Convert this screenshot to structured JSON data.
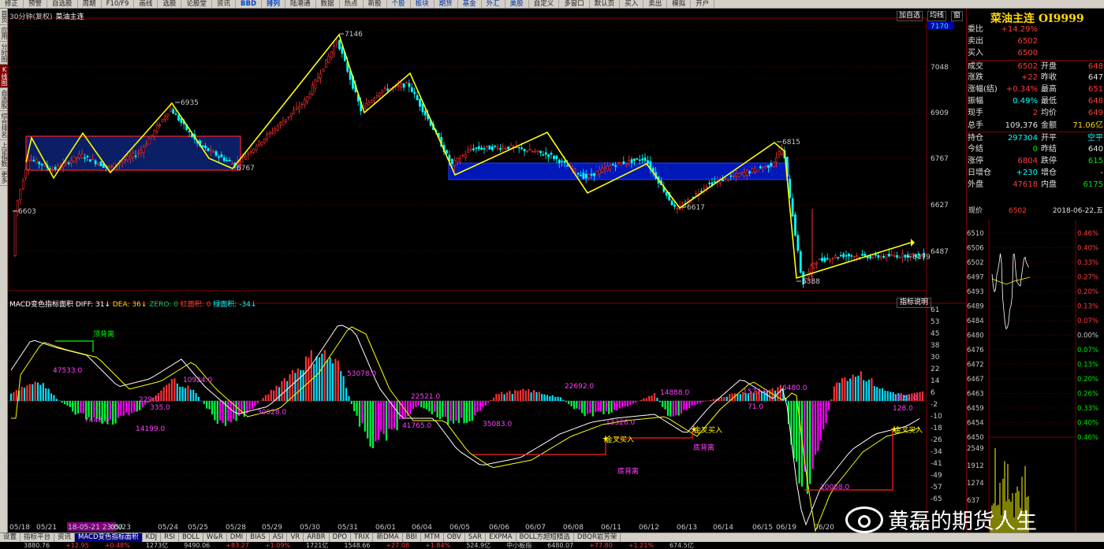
{
  "toolbar": {
    "items": [
      "修正",
      "预警",
      "自选股",
      "周期",
      "F10/F9",
      "画线",
      "选股",
      "论股堂",
      "资讯",
      "BBD",
      "排列",
      "陆港通",
      "数据",
      "热点",
      "新股",
      "个股",
      "板块",
      "期货",
      "基金",
      "外汇",
      "美股",
      "自定义",
      "多窗口",
      "默认页",
      "买入",
      "卖出",
      "模拟",
      "开户"
    ]
  },
  "sidebar": {
    "tabs": [
      "首页",
      "应用",
      "分时图",
      "K线图",
      "自选股",
      "综合排名",
      "上证指数",
      "更多"
    ],
    "active": "K线图"
  },
  "chart_header": {
    "period": "30分钟(复权)",
    "title": "菜油主连"
  },
  "chart_tools": [
    "加自选",
    "均线",
    "窗"
  ],
  "macd_header": {
    "name": "MACD变色指标面积",
    "diff": "DIFF: 31",
    "dea": "DEA: 36",
    "zero": "ZERO: 0",
    "red_area": "红面积: 0",
    "green_area": "绿面积: -34",
    "help": "指标说明"
  },
  "quote": {
    "title": "菜油主连 OI9999",
    "rows": [
      {
        "l": "委比",
        "v": "+14.29%",
        "vc": "red"
      },
      {
        "l": "卖出",
        "v": "6502",
        "vc": "red"
      },
      {
        "l": "买入",
        "v": "6500",
        "vc": "red"
      },
      {
        "l": "成交",
        "v": "6502",
        "vc": "red",
        "l2": "开盘",
        "v2": "648",
        "v2c": "red",
        "sep": true
      },
      {
        "l": "涨跌",
        "v": "+22",
        "vc": "red",
        "l2": "昨收",
        "v2": "647",
        "v2c": "white"
      },
      {
        "l": "涨幅(结)",
        "v": "+0.34%",
        "vc": "red",
        "l2": "最高",
        "v2": "651",
        "v2c": "red"
      },
      {
        "l": "振幅",
        "v": "0.49%",
        "vc": "cyan",
        "l2": "最低",
        "v2": "648",
        "v2c": "red"
      },
      {
        "l": "现手",
        "v": "2",
        "vc": "red",
        "l2": "均价",
        "v2": "649",
        "v2c": "red"
      },
      {
        "l": "总手",
        "v": "109,376",
        "vc": "white",
        "l2": "金额",
        "v2": "71.06亿",
        "v2c": "yellow"
      },
      {
        "l": "持仓",
        "v": "297304",
        "vc": "cyan",
        "l2": "开平",
        "v2": "空平",
        "v2c": "cyan",
        "sep": true
      },
      {
        "l": "今结",
        "v": "0",
        "vc": "green",
        "l2": "昨结",
        "v2": "640",
        "v2c": "white"
      },
      {
        "l": "涨停",
        "v": "6804",
        "vc": "red",
        "l2": "跌停",
        "v2": "615",
        "v2c": "green"
      },
      {
        "l": "日增仓",
        "v": "+230",
        "vc": "cyan",
        "l2": "增仓",
        "v2": "-",
        "v2c": "white"
      },
      {
        "l": "外盘",
        "v": "47618",
        "vc": "red",
        "l2": "内盘",
        "v2": "6175",
        "v2c": "green"
      }
    ],
    "info_label": "现价",
    "info_price": "6502",
    "info_date": "2018-06-22,五",
    "mini_left_ticks": [
      "6510",
      "6506",
      "6502",
      "6497",
      "6493",
      "6489",
      "6484",
      "6480",
      "6476",
      "6472",
      "6467",
      "6463",
      "6459",
      "6454",
      "6450",
      "2549",
      "1912",
      "1274",
      "637"
    ],
    "mini_right_ticks": [
      "0.46%",
      "0.40%",
      "0.33%",
      "0.27%",
      "0.20%",
      "0.13%",
      "0.07%",
      "0.00%",
      "0.07%",
      "0.13%",
      "0.20%",
      "0.26%",
      "0.33%",
      "0.40%",
      "0.46%"
    ]
  },
  "y_axis_main": [
    "7170",
    "7048",
    "6909",
    "6767",
    "6627",
    "6487"
  ],
  "y_axis_macd": [
    "61",
    "53",
    "45",
    "38",
    "30",
    "22",
    "14",
    "6",
    "-2",
    "-10",
    "-18",
    "-26",
    "-34",
    "-41",
    "-49",
    "-57",
    "-65"
  ],
  "x_axis": [
    "05/18",
    "05/21",
    "18-05-21 23:00",
    "05/23",
    "05/24",
    "05/25",
    "05/28",
    "05/29",
    "05/30",
    "05/31",
    "06/01",
    "06/04",
    "06/05",
    "06/06",
    "06/07",
    "06/08",
    "06/11",
    "06/12",
    "06/13",
    "06/14",
    "06/15",
    "06/19",
    "06/20"
  ],
  "price_labels": [
    "7146",
    "6935",
    "6603",
    "6767",
    "6815",
    "6617",
    "6388",
    "6479"
  ],
  "macd_labels": [
    "47533.0",
    "10924.0",
    "53078.0",
    "7448.0",
    "14199.0",
    "335.0",
    "30028.0",
    "41765.0",
    "35083.0",
    "22692.0",
    "14888.0",
    "13326.0",
    "6480.0",
    "71.0",
    "128.0",
    "20068.0",
    "22521.0",
    "3829.0",
    "1577.0",
    "229.0"
  ],
  "annotations": {
    "top_div": "顶背离",
    "bottom_div1": "底背离",
    "bottom_div2": "底背离",
    "gold_cross": "金叉买入"
  },
  "tabs": [
    "设置",
    "指标平台",
    "资讯",
    "MACD变色指标面积",
    "KDJ",
    "RSI",
    "BOLL",
    "W&R",
    "DMI",
    "BIAS",
    "ASI",
    "VR",
    "ARBR",
    "DPO",
    "TRIX",
    "新DMA",
    "BBI",
    "MTM",
    "OBV",
    "SAR",
    "EXPMA",
    "BOLL方超短精选",
    "DBQR岩芳荣"
  ],
  "active_tab": "MACD变色指标面积",
  "statusbar": [
    "3880.76",
    "+12.95",
    "+0.48%",
    "1273亿",
    "9490.06",
    "+83.27",
    "+1.09%",
    "1721亿",
    "1548.66",
    "+27.08",
    "+1.84%",
    "524.9亿",
    "中小板指",
    "6480.07",
    "+77.80",
    "+1.21%",
    "674.5亿"
  ],
  "watermark": "黄磊的期货人生",
  "chart_data": {
    "type": "candlestick",
    "title": "菜油主连 30分钟(复权)",
    "symbol": "OI9999",
    "x_labels": [
      "05/18",
      "05/21",
      "05/23",
      "05/24",
      "05/25",
      "05/28",
      "05/29",
      "05/30",
      "05/31",
      "06/01",
      "06/04",
      "06/05",
      "06/06",
      "06/07",
      "06/08",
      "06/11",
      "06/12",
      "06/13",
      "06/14",
      "06/15",
      "06/19",
      "06/20"
    ],
    "y_ticks": [
      7170,
      7048,
      6909,
      6767,
      6627,
      6487
    ],
    "swing_points": [
      {
        "label": "6603",
        "value": 6603
      },
      {
        "label": "7146",
        "value": 7146
      },
      {
        "label": "6935",
        "value": 6935
      },
      {
        "label": "6767",
        "value": 6767
      },
      {
        "label": "6815",
        "value": 6815
      },
      {
        "label": "6617",
        "value": 6617
      },
      {
        "label": "6388",
        "value": 6388
      },
      {
        "label": "6479",
        "value": 6479
      }
    ],
    "zones": [
      {
        "from": "05/18",
        "to": "05/28",
        "top": 6800,
        "bottom": 6740,
        "color": "#0b1f66"
      },
      {
        "from": "06/05",
        "to": "06/19",
        "top": 6771,
        "bottom": 6748,
        "color": "#0016b0"
      }
    ],
    "macd": {
      "diff": 31,
      "dea": 36,
      "ylim": [
        -65,
        61
      ]
    }
  }
}
